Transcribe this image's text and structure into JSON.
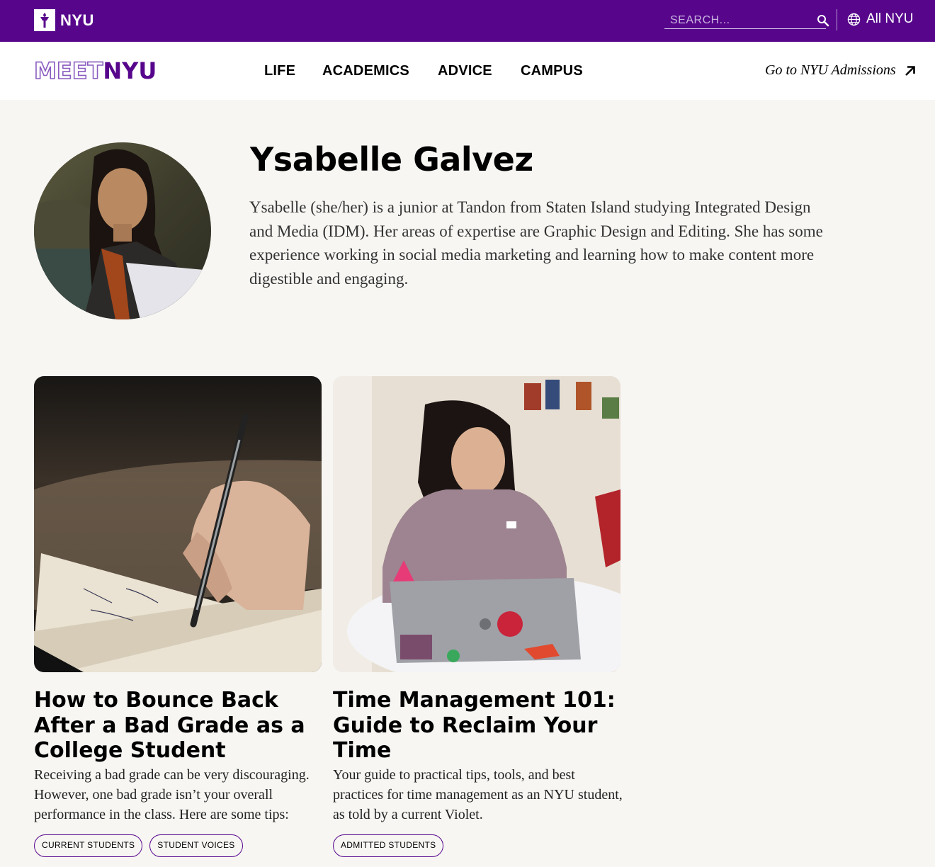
{
  "topbar": {
    "logo_text": "NYU",
    "search_placeholder": "SEARCH...",
    "all_nyu_label": "All NYU"
  },
  "nav": {
    "logo_meet": "MEET",
    "logo_nyu": "NYU",
    "links": [
      "LIFE",
      "ACADEMICS",
      "ADVICE",
      "CAMPUS"
    ],
    "admissions_label": "Go to NYU Admissions"
  },
  "profile": {
    "name": "Ysabelle Galvez",
    "bio": "Ysabelle (she/her) is a junior at Tandon from Staten Island studying Integrated Design and Media (IDM). Her areas of expertise are Graphic Design and Editing. She has some experience working in social media marketing and learning how to make content more digestible and engaging."
  },
  "articles": [
    {
      "title": "How to Bounce Back After a Bad Grade as a College Student",
      "description": "Receiving a bad grade can be very discouraging. However, one bad grade isn’t your overall performance in the class. Here are some tips:",
      "tags": [
        "CURRENT STUDENTS",
        "STUDENT VOICES"
      ]
    },
    {
      "title": "Time Management 101: Guide to Reclaim Your Time",
      "description": "Your guide to practical tips, tools,  and best practices for time management as an NYU student, as told by a current Violet.",
      "tags": [
        "ADMITTED STUDENTS"
      ]
    }
  ],
  "colors": {
    "brand_purple": "#57068c",
    "page_background": "#f7f6f3"
  }
}
